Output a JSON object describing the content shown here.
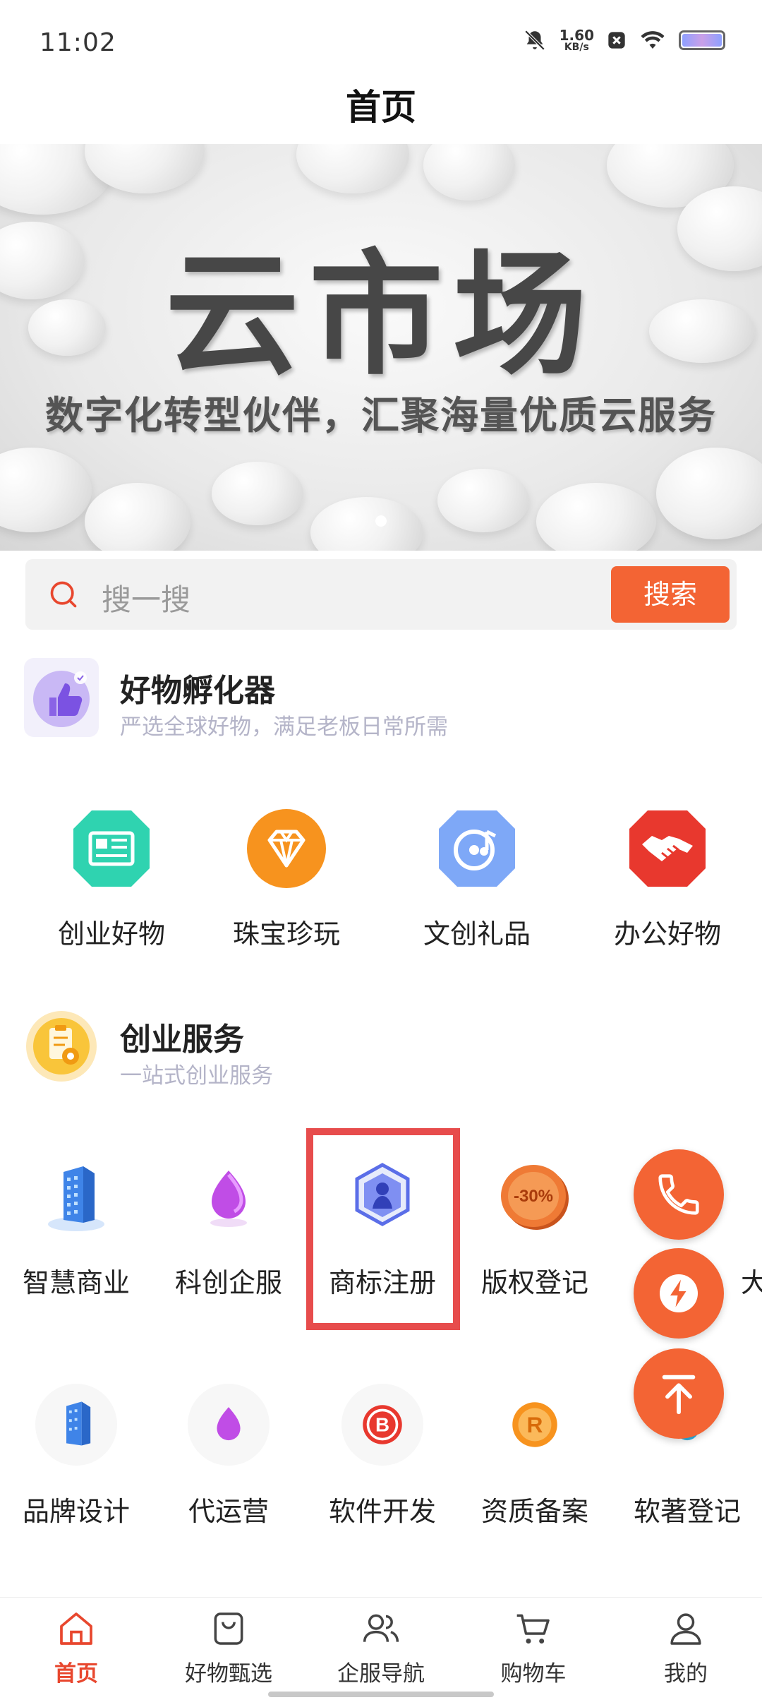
{
  "status_bar": {
    "time": "11:02",
    "net_speed_value": "1.60",
    "net_speed_unit": "KB/s",
    "icons": [
      "mute-icon",
      "close-box-icon",
      "wifi-icon",
      "battery-icon"
    ]
  },
  "header": {
    "title": "首页"
  },
  "banner": {
    "title": "云市场",
    "subtitle": "数字化转型伙伴，汇聚海量优质云服务",
    "slide_count": 1,
    "active_slide": 1
  },
  "search": {
    "placeholder": "搜一搜",
    "button_label": "搜索"
  },
  "incubator": {
    "title": "好物孵化器",
    "subtitle": "严选全球好物，满足老板日常所需",
    "icon": "thumbs-up-icon",
    "items": [
      {
        "label": "创业好物",
        "icon": "newspaper-icon",
        "color": "#2fd3b0"
      },
      {
        "label": "珠宝珍玩",
        "icon": "diamond-icon",
        "color": "#f7931e"
      },
      {
        "label": "文创礼品",
        "icon": "music-disc-icon",
        "color": "#7ea8f7"
      },
      {
        "label": "办公好物",
        "icon": "handshake-icon",
        "color": "#e8382e"
      }
    ]
  },
  "startup": {
    "title": "创业服务",
    "subtitle": "一站式创业服务",
    "icon": "clipboard-icon",
    "row1": [
      {
        "label": "智慧商业",
        "icon": "building-icon"
      },
      {
        "label": "科创企服",
        "icon": "purple-drop-icon"
      },
      {
        "label": "商标注册",
        "icon": "trademark-shield-icon"
      },
      {
        "label": "版权登记",
        "icon": "discount-coin-icon"
      },
      {
        "label": "大",
        "icon": "partial-icon"
      }
    ],
    "row2": [
      {
        "label": "品牌设计",
        "icon": "building-icon"
      },
      {
        "label": "代运营",
        "icon": "purple-drop-icon"
      },
      {
        "label": "软件开发",
        "icon": "b-coin-icon"
      },
      {
        "label": "资质备案",
        "icon": "r-coin-icon"
      },
      {
        "label": "软著登记",
        "icon": "blue-drop-icon"
      }
    ]
  },
  "floating": {
    "buttons": [
      "phone-icon",
      "lightning-icon",
      "back-to-top-icon"
    ],
    "color": "#f36434"
  },
  "tabbar": {
    "active_color": "#e8472e",
    "items": [
      {
        "label": "首页",
        "icon": "home-icon",
        "active": true
      },
      {
        "label": "好物甄选",
        "icon": "shopping-bag-icon",
        "active": false
      },
      {
        "label": "企服导航",
        "icon": "users-icon",
        "active": false
      },
      {
        "label": "购物车",
        "icon": "cart-icon",
        "active": false
      },
      {
        "label": "我的",
        "icon": "user-icon",
        "active": false
      }
    ]
  }
}
